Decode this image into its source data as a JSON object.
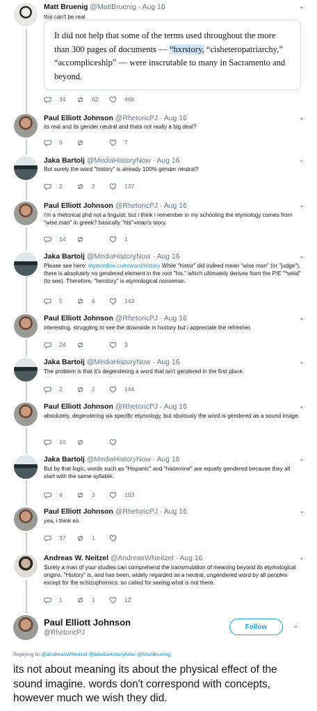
{
  "tweets": [
    {
      "avatar": "matt",
      "name": "Matt Bruenig",
      "handle": "@MattBruenig",
      "date": "Aug 16",
      "text": "this can't be real",
      "quote": {
        "before": "It did not help that some of the terms used throughout the more than 300 pages of documents — ",
        "highlight": "“hxrstory,",
        "after": " “cisheteropatriarchy,” “accompliceship” — were inscrutable to many in Sacramento and beyond."
      },
      "replies": "34",
      "retweets": "62",
      "likes": "468"
    },
    {
      "avatar": "paul",
      "name": "Paul Elliott Johnson",
      "handle": "@RhetoricPJ",
      "date": "Aug 16",
      "text": "its real and its gender neutral and thats not really a big deal?",
      "replies": "9",
      "retweets": "",
      "likes": "7"
    },
    {
      "avatar": "jaka",
      "name": "Jaka Bartolj",
      "handle": "@MediaHistoryNow",
      "date": "Aug 16",
      "text": "But surely the word \"history\" is already 100% gender neutral?",
      "replies": "2",
      "retweets": "2",
      "likes": "137"
    },
    {
      "avatar": "paul",
      "name": "Paul Elliott Johnson",
      "handle": "@RhetoricPJ",
      "date": "Aug 16",
      "text": "i'm a rhetorical phd not a linguist, but i think i remember in my schooling the etymology comes from \"wise man\" in greek? basically \"his\"=man's story.",
      "replies": "14",
      "retweets": "",
      "likes": "1"
    },
    {
      "avatar": "jaka",
      "name": "Jaka Bartolj",
      "handle": "@MediaHistoryNow",
      "date": "Aug 16",
      "text_pre": "Please see here: ",
      "text_link": "etymonline.com/word/history",
      "text": " While \"histor\" did indeed mean \"wise man\" (or \"judge\"), there is absolutely no gendered element in the root \"his,\" which ultimately derives from the PIE \"*weid\" (to see). Therefore, \"herstory\" is etymological nonsense.",
      "replies": "5",
      "retweets": "6",
      "likes": "143"
    },
    {
      "avatar": "paul",
      "name": "Paul Elliott Johnson",
      "handle": "@RhetoricPJ",
      "date": "Aug 16",
      "text": "interesting. struggling to see the downside in hxstory but i appreciate the refresher.",
      "replies": "24",
      "retweets": "",
      "likes": "3"
    },
    {
      "avatar": "jaka",
      "name": "Jaka Bartolj",
      "handle": "@MediaHistoryNow",
      "date": "Aug 16",
      "text": "The problem is that it's degendering a word that isn't gendered in the first place.",
      "replies": "2",
      "retweets": "2",
      "likes": "144"
    },
    {
      "avatar": "paul",
      "name": "Paul Elliott Johnson",
      "handle": "@RhetoricPJ",
      "date": "Aug 16",
      "text": "absolutely. degendering via specific etymology. but obviously the word is gendered as a sound image.",
      "replies": "10",
      "retweets": "",
      "likes": ""
    },
    {
      "avatar": "jaka",
      "name": "Jaka Bartolj",
      "handle": "@MediaHistoryNow",
      "date": "Aug 16",
      "text": "But by that logic, words such as \"Hispanic\" and \"histamine\" are equally gendered because they all start with the same syllable.",
      "replies": "4",
      "retweets": "3",
      "likes": "163"
    },
    {
      "avatar": "paul",
      "name": "Paul Elliott Johnson",
      "handle": "@RhetoricPJ",
      "date": "Aug 16",
      "text": "yea, i think so.",
      "replies": "37",
      "retweets": "1",
      "likes": ""
    },
    {
      "avatar": "andreas",
      "name": "Andreas W. Neitzel",
      "handle": "@AndreasWNeitzel",
      "date": "Aug 16",
      "text": "Surely a man of your studies can comprehend the transmutation of meaning beyond its etymological origins. \"History\" is, and has been, widely regarded as a neutral, ungendered word by all peoples except for the schizophrenics, so called for seeing what is not there.",
      "replies": "1",
      "retweets": "1",
      "likes": "12"
    }
  ],
  "main_tweet": {
    "name": "Paul Elliott Johnson",
    "handle": "@RhetoricPJ",
    "follow_label": "Follow",
    "replying_prefix": "Replying to",
    "replying_to": "@AndreasWNeitzel @MediaHistoryNow @MattBruenig",
    "text": "its not about meaning its about the physical effect of the sound imagine. words don't correspond with concepts, however much we wish they did."
  },
  "colors": {
    "accent": "#1da1f2",
    "link": "#1b95e0",
    "muted": "#657786",
    "thread_line": "#c4d0d9",
    "highlight": "#cfe6fb"
  },
  "icons": {
    "reply": "speech-bubble-icon",
    "retweet": "retweet-arrows-icon",
    "like": "heart-icon",
    "caret": "chevron-down-icon"
  }
}
